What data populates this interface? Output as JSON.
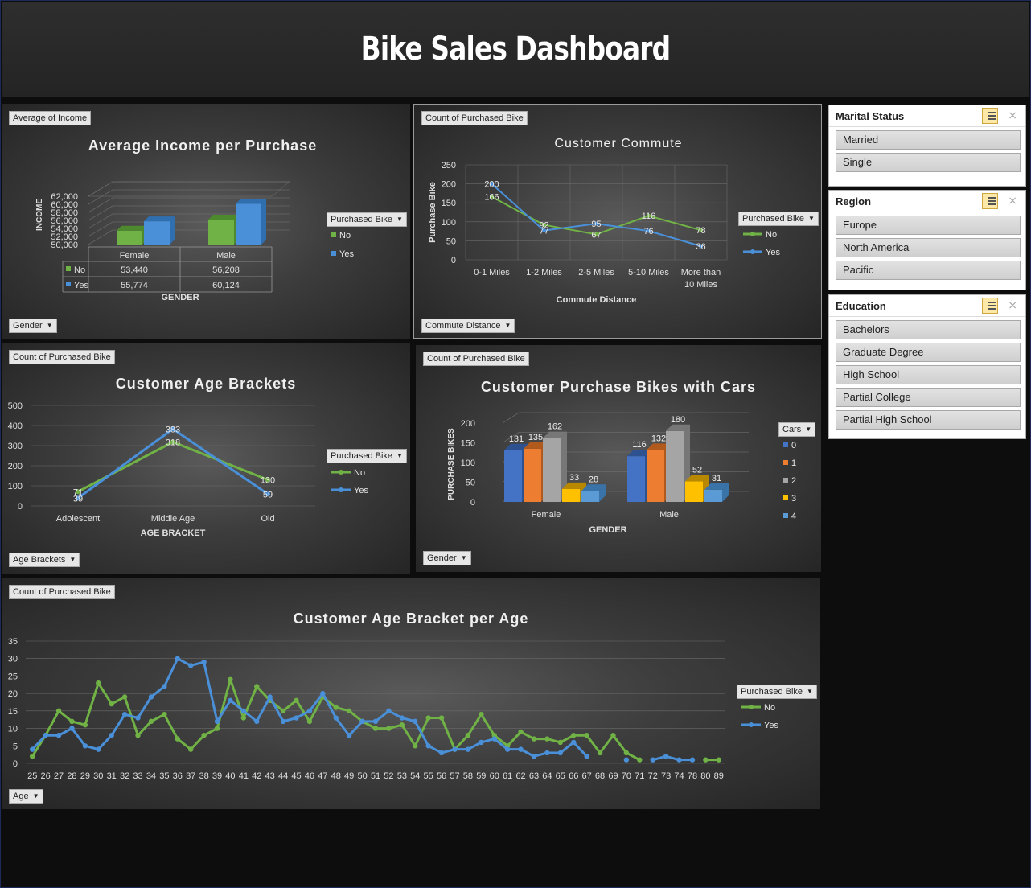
{
  "dashboard": {
    "title": "Bike Sales Dashboard"
  },
  "colors": {
    "green": "#70b245",
    "blue": "#4a90d9"
  },
  "panels": {
    "income": {
      "tag": "Average of Income",
      "filter": "Gender",
      "legend_title": "Purchased Bike",
      "legend": [
        "No",
        "Yes"
      ]
    },
    "commute": {
      "tag": "Count of Purchased Bike",
      "filter": "Commute Distance",
      "legend_title": "Purchased Bike",
      "legend": [
        "No",
        "Yes"
      ]
    },
    "age": {
      "tag": "Count of Purchased Bike",
      "filter": "Age Brackets",
      "legend_title": "Purchased Bike",
      "legend": [
        "No",
        "Yes"
      ]
    },
    "cars": {
      "tag": "Count of Purchased Bike",
      "filter": "Gender",
      "legend_title": "Cars",
      "legend": [
        "0",
        "1",
        "2",
        "3",
        "4"
      ]
    },
    "ageper": {
      "tag": "Count of Purchased Bike",
      "filter": "Age",
      "legend_title": "Purchased Bike",
      "legend": [
        "No",
        "Yes"
      ]
    }
  },
  "slicers": {
    "marital": {
      "title": "Marital Status",
      "items": [
        "Married",
        "Single"
      ]
    },
    "region": {
      "title": "Region",
      "items": [
        "Europe",
        "North America",
        "Pacific"
      ]
    },
    "education": {
      "title": "Education",
      "items": [
        "Bachelors",
        "Graduate Degree",
        "High School",
        "Partial College",
        "Partial High School"
      ]
    }
  },
  "chart_data": [
    {
      "id": "income",
      "type": "bar",
      "title": "Average Income per Purchase",
      "xlabel": "GENDER",
      "ylabel": "INCOME",
      "categories": [
        "Female",
        "Male"
      ],
      "series": [
        {
          "name": "No",
          "values": [
            53440,
            56208
          ],
          "labels": [
            "53,440",
            "56,208"
          ]
        },
        {
          "name": "Yes",
          "values": [
            55774,
            60124
          ],
          "labels": [
            "55,774",
            "60,124"
          ]
        }
      ],
      "ylim": [
        50000,
        62000
      ],
      "yticks": [
        "50,000",
        "52,000",
        "54,000",
        "56,000",
        "58,000",
        "60,000",
        "62,000"
      ]
    },
    {
      "id": "commute",
      "type": "line",
      "title": "Customer Commute",
      "xlabel": "Commute Distance",
      "ylabel": "Purchase Bike",
      "categories": [
        "0-1 Miles",
        "1-2 Miles",
        "2-5 Miles",
        "5-10 Miles",
        "More than 10 Miles"
      ],
      "series": [
        {
          "name": "No",
          "values": [
            166,
            92,
            67,
            116,
            78
          ]
        },
        {
          "name": "Yes",
          "values": [
            200,
            77,
            95,
            76,
            36
          ]
        }
      ],
      "ylim": [
        0,
        250
      ]
    },
    {
      "id": "age",
      "type": "line",
      "title": "Customer Age Brackets",
      "xlabel": "AGE BRACKET",
      "ylabel": "",
      "categories": [
        "Adolescent",
        "Middle Age",
        "Old"
      ],
      "series": [
        {
          "name": "No",
          "values": [
            71,
            318,
            130
          ]
        },
        {
          "name": "Yes",
          "values": [
            39,
            383,
            59
          ]
        }
      ],
      "ylim": [
        0,
        500
      ]
    },
    {
      "id": "cars",
      "type": "bar",
      "title": "Customer Purchase Bikes with Cars",
      "xlabel": "GENDER",
      "ylabel": "PURCHASE BIKES",
      "categories": [
        "Female",
        "Male"
      ],
      "series": [
        {
          "name": "0",
          "values": [
            131,
            116
          ]
        },
        {
          "name": "1",
          "values": [
            135,
            132
          ]
        },
        {
          "name": "2",
          "values": [
            162,
            180
          ]
        },
        {
          "name": "3",
          "values": [
            33,
            52
          ]
        },
        {
          "name": "4",
          "values": [
            28,
            31
          ]
        }
      ],
      "ylim": [
        0,
        200
      ]
    },
    {
      "id": "ageper",
      "type": "line",
      "title": "Customer Age Bracket per Age",
      "xlabel": "",
      "ylabel": "",
      "categories": [
        "25",
        "26",
        "27",
        "28",
        "29",
        "30",
        "31",
        "32",
        "33",
        "34",
        "35",
        "36",
        "37",
        "38",
        "39",
        "40",
        "41",
        "42",
        "43",
        "44",
        "45",
        "46",
        "47",
        "48",
        "49",
        "50",
        "51",
        "52",
        "53",
        "54",
        "55",
        "56",
        "57",
        "58",
        "59",
        "60",
        "61",
        "62",
        "63",
        "64",
        "65",
        "66",
        "67",
        "68",
        "69",
        "70",
        "71",
        "72",
        "73",
        "74",
        "78",
        "80",
        "89"
      ],
      "series": [
        {
          "name": "No",
          "values": [
            2,
            8,
            15,
            12,
            11,
            23,
            17,
            19,
            8,
            12,
            14,
            7,
            4,
            8,
            10,
            24,
            13,
            22,
            18,
            15,
            18,
            12,
            19,
            16,
            15,
            12,
            10,
            10,
            11,
            5,
            13,
            13,
            4,
            8,
            14,
            8,
            5,
            9,
            7,
            7,
            6,
            8,
            8,
            3,
            8,
            3,
            1,
            null,
            null,
            null,
            null,
            1,
            1
          ]
        },
        {
          "name": "Yes",
          "values": [
            4,
            8,
            8,
            10,
            5,
            4,
            8,
            14,
            13,
            19,
            22,
            30,
            28,
            29,
            12,
            18,
            15,
            12,
            19,
            12,
            13,
            15,
            20,
            13,
            8,
            12,
            12,
            15,
            13,
            12,
            5,
            3,
            4,
            4,
            6,
            7,
            4,
            4,
            2,
            3,
            3,
            6,
            2,
            null,
            null,
            1,
            null,
            1,
            2,
            1,
            1,
            null,
            null
          ]
        }
      ],
      "ylim": [
        0,
        35
      ]
    }
  ]
}
